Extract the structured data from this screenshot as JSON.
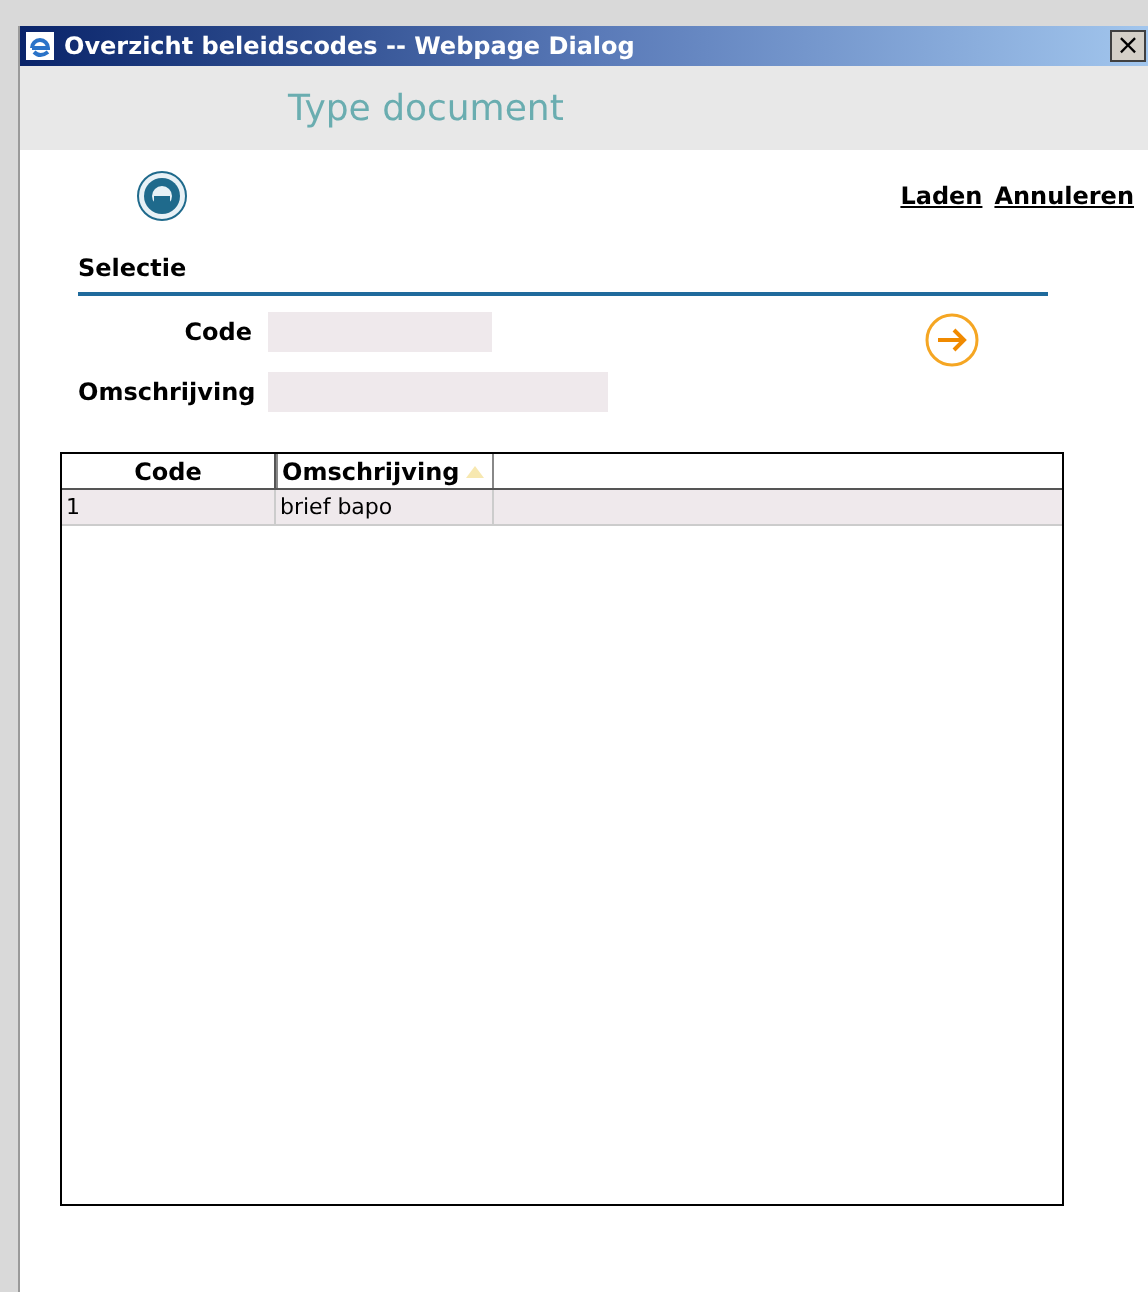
{
  "window": {
    "title": "Overzicht beleidscodes -- Webpage Dialog",
    "close": "×"
  },
  "header": {
    "title": "Type document"
  },
  "actions": [
    "Laden",
    "Annuleren"
  ],
  "selection": {
    "title": "Selectie",
    "fields": [
      {
        "label": "Code"
      },
      {
        "label": "Omschrijving"
      }
    ]
  },
  "table": {
    "columns": [
      {
        "label": "Code",
        "sorted": false
      },
      {
        "label": "Omschrijving",
        "sorted": true
      }
    ],
    "rows": [
      {
        "cells": [
          "1",
          "brief bapo"
        ],
        "selected": true
      }
    ]
  }
}
